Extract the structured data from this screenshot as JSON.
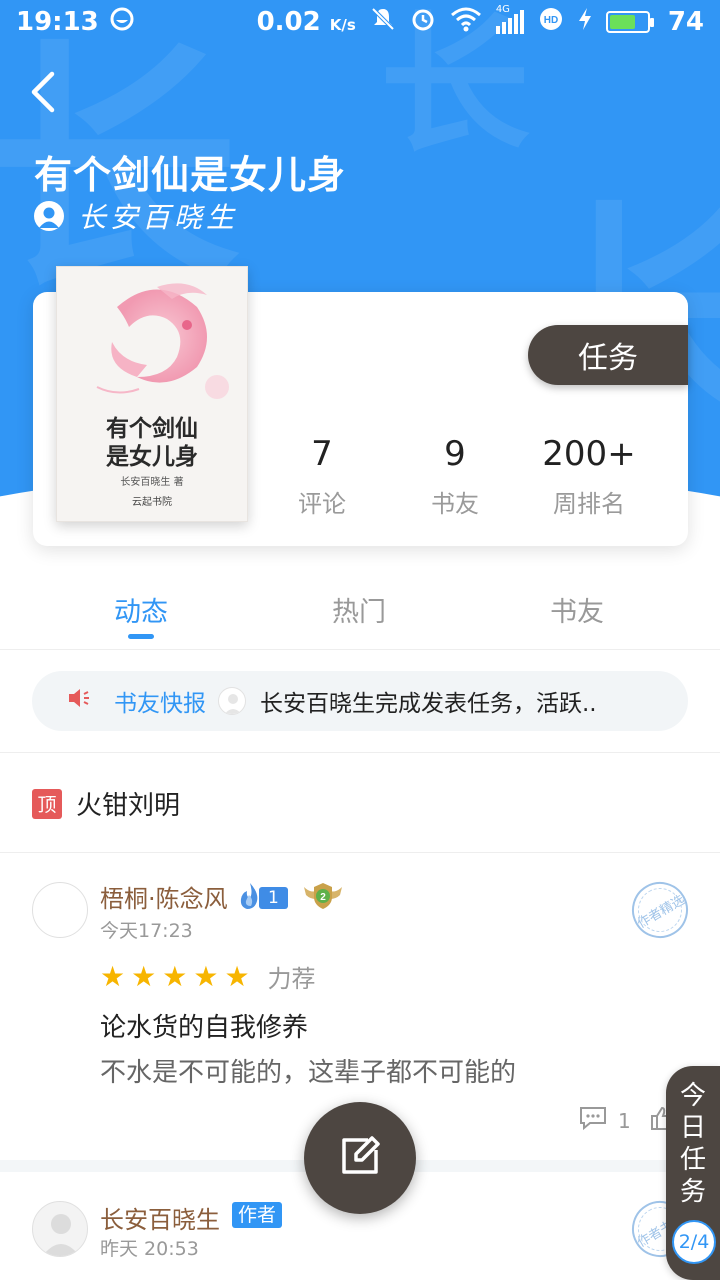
{
  "status_bar": {
    "time": "19:13",
    "speed": "0.02",
    "speed_unit": "K/s",
    "network": "4G",
    "battery": "74",
    "battery_level": 0.74
  },
  "colors": {
    "header_blue": "#3196F5",
    "dark_button": "#4D4641",
    "username_brown": "#8B5E3C",
    "star_gold": "#F7B500",
    "pin_red": "#E55A5A"
  },
  "header": {
    "title": "有个剑仙是女儿身",
    "author": "长安百晓生",
    "bg_chars": [
      "长",
      "长",
      "长"
    ]
  },
  "cover": {
    "title_line1": "有个剑仙",
    "title_line2": "是女儿身",
    "author": "长安百晓生 著",
    "publisher": "云起书院"
  },
  "task_button": "任务",
  "stats": [
    {
      "value": "7",
      "label": "评论"
    },
    {
      "value": "9",
      "label": "书友"
    },
    {
      "value": "200+",
      "label": "周排名"
    }
  ],
  "tabs": [
    {
      "label": "动态",
      "active": true
    },
    {
      "label": "热门",
      "active": false
    },
    {
      "label": "书友",
      "active": false
    }
  ],
  "ticker": {
    "label": "书友快报",
    "text": "长安百晓生完成发表任务，活跃.."
  },
  "pinned": {
    "badge": "顶",
    "name": "火钳刘明"
  },
  "posts": [
    {
      "username": "梧桐·陈念风",
      "level": "1",
      "fan_level": "2",
      "time": "今天17:23",
      "stamp": "作者精选",
      "rating": 5,
      "rating_label": "力荐",
      "title": "论水货的自我修养",
      "body": "不水是不可能的，这辈子都不可能的",
      "comments": "1"
    },
    {
      "username": "长安百晓生",
      "tag": "作者",
      "time": "昨天 20:53",
      "stamp": "作者书评"
    }
  ],
  "daily_task": {
    "label": "今日任务",
    "count": "2/4"
  }
}
